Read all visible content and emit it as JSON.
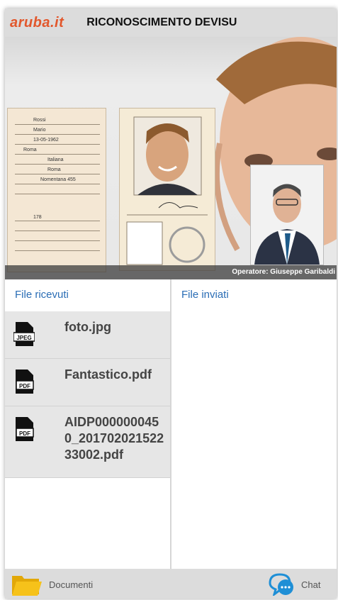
{
  "app": {
    "logo": "aruba.it",
    "title": "RICONOSCIMENTO DEVISU"
  },
  "video": {
    "operator_caption": "Operatore: Giuseppe Garibaldi",
    "id_card_fields": [
      "Rossi",
      "Mario",
      "13-05-1962",
      "Roma",
      "Italiana",
      "Roma",
      "Nomentana 455",
      "178"
    ]
  },
  "received": {
    "title": "File ricevuti",
    "files": [
      {
        "name": "foto.jpg",
        "icon": "jpeg-file-icon",
        "badge": "JPEG"
      },
      {
        "name": "Fantastico.pdf",
        "icon": "pdf-file-icon",
        "badge": "PDF"
      },
      {
        "name": "AIDP0000000450_20170202152233002.pdf",
        "icon": "pdf-file-icon",
        "badge": "PDF"
      }
    ]
  },
  "sent": {
    "title": "File inviati"
  },
  "bottom": {
    "documents_label": "Documenti",
    "chat_label": "Chat"
  },
  "colors": {
    "accent": "#2a6db5",
    "logo": "#e2572c",
    "bar": "#dcdcdc",
    "folder": "#f6c21a",
    "chat": "#1f8fd6"
  }
}
